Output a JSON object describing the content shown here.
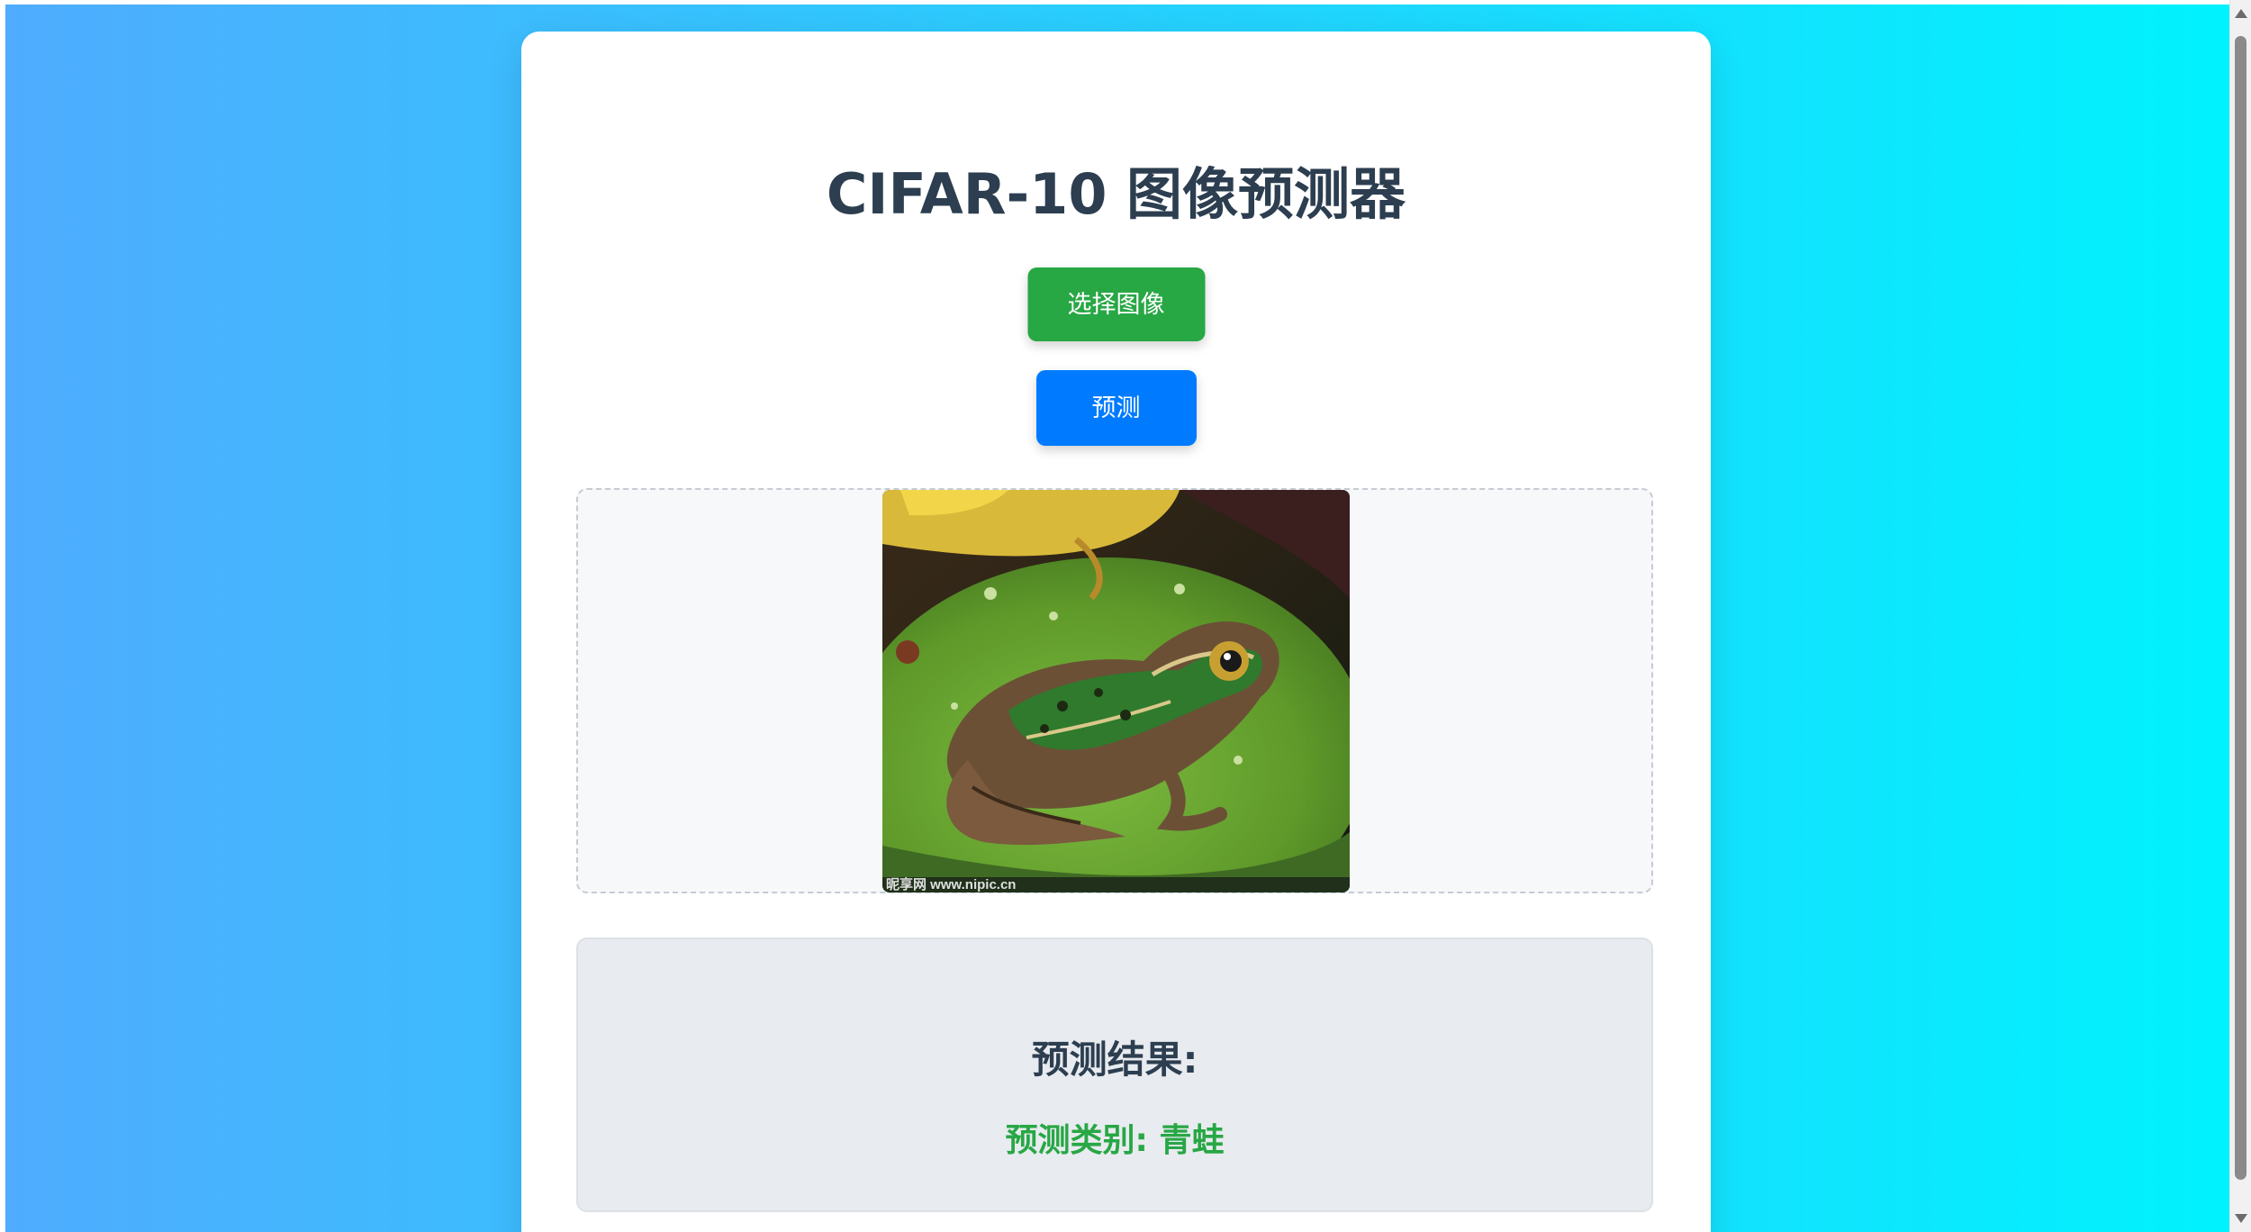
{
  "page": {
    "title": "CIFAR-10 图像预测器"
  },
  "buttons": {
    "select_image": "选择图像",
    "predict": "预测"
  },
  "preview": {
    "image": "frog-on-lily-pad-photo",
    "watermark": "昵享网 www.nipic.cn"
  },
  "result": {
    "title": "预测结果:",
    "class_text": "预测类别: 青蛙"
  },
  "colors": {
    "background_gradient_start": "#4facfe",
    "background_gradient_end": "#00f2fe",
    "select_button": "#28a745",
    "predict_button": "#007bff",
    "title_text": "#2c3e50",
    "result_class_text": "#28a745",
    "result_panel": "#e8ebef"
  }
}
